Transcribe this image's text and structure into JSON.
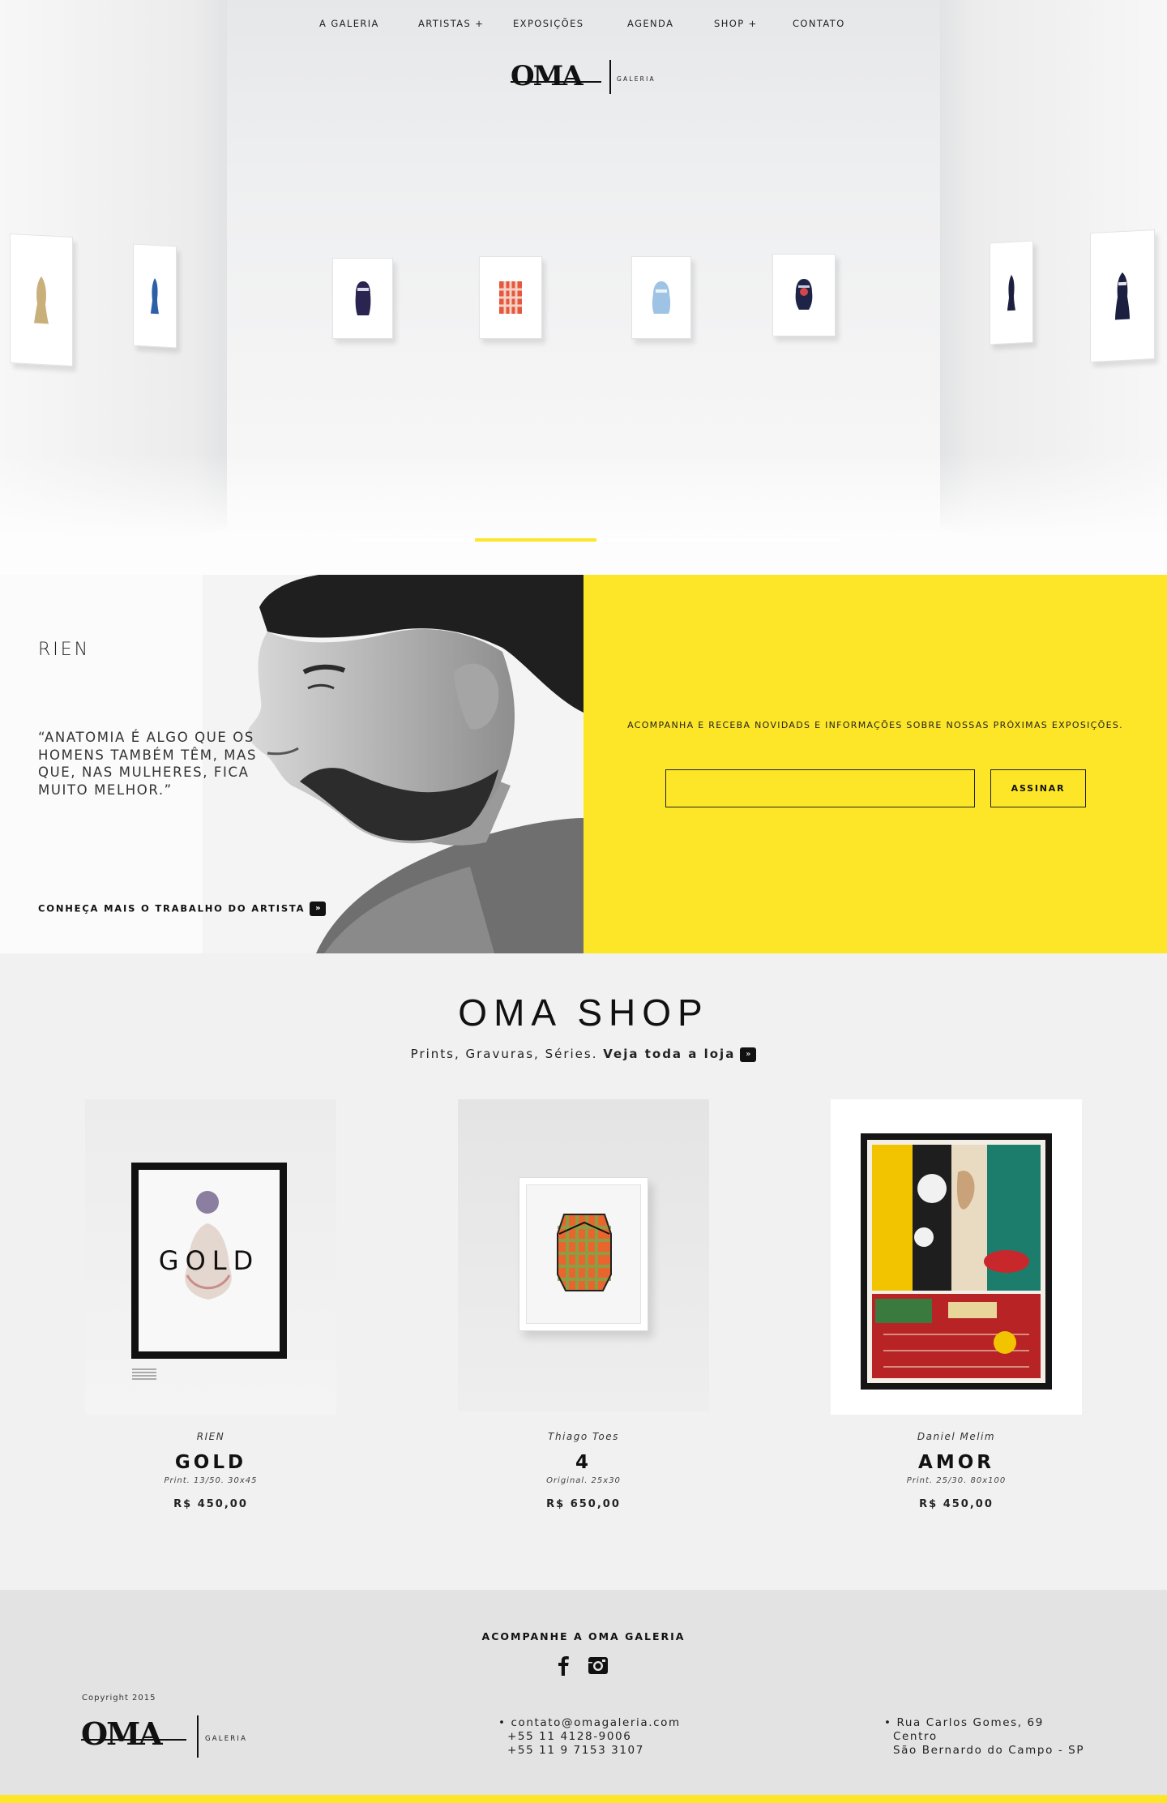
{
  "nav": {
    "items": [
      {
        "label": "A GALERIA"
      },
      {
        "label": "ARTISTAS +"
      },
      {
        "label": "EXPOSIÇÕES"
      },
      {
        "label": "AGENDA"
      },
      {
        "label": "SHOP +"
      },
      {
        "label": "CONTATO"
      }
    ]
  },
  "brand": {
    "logo_text": "OMA",
    "logo_sub": "GALERIA"
  },
  "hero": {
    "slider_active_index": 1,
    "slider_count": 4
  },
  "artist": {
    "name": "RIEN",
    "quote": "“ANATOMIA É ALGO QUE OS HOMENS TAMBÉM TÊM, MAS QUE, NAS MULHERES, FICA MUITO MELHOR.”",
    "link_label": "CONHEÇA MAIS O TRABALHO DO ARTISTA"
  },
  "newsletter": {
    "text": "ACOMPANHA E RECEBA NOVIDADS E INFORMAÇÕES SOBRE NOSSAS PRÓXIMAS EXPOSIÇÕES.",
    "input_value": "",
    "button_label": "ASSINAR"
  },
  "shop": {
    "title": "OMA SHOP",
    "subtitle": "Prints, Gravuras, Séries.",
    "link_label": "Veja toda a loja",
    "products": [
      {
        "artist": "RIEN",
        "name": "GOLD",
        "spec": "Print. 13/50. 30x45",
        "price": "R$ 450,00",
        "art_text": "GOLD"
      },
      {
        "artist": "Thiago Toes",
        "name": "4",
        "spec": "Original. 25x30",
        "price": "R$ 650,00"
      },
      {
        "artist": "Daniel Melim",
        "name": "AMOR",
        "spec": "Print. 25/30. 80x100",
        "price": "R$ 450,00"
      }
    ]
  },
  "footer": {
    "follow": "ACOMPANHE A OMA GALERIA",
    "social": [
      "facebook-icon",
      "instagram-icon"
    ],
    "copyright": "Copyright 2015",
    "contact": [
      "• contato@omagaleria.com",
      "+55 11 4128-9006",
      "+55 11 9 7153 3107"
    ],
    "address": [
      "• Rua Carlos Gomes, 69",
      "Centro",
      "São Bernardo do Campo - SP"
    ]
  },
  "colors": {
    "accent": "#fde627",
    "text": "#111111",
    "background": "#f1f1f1",
    "footer": "#e3e3e3"
  }
}
